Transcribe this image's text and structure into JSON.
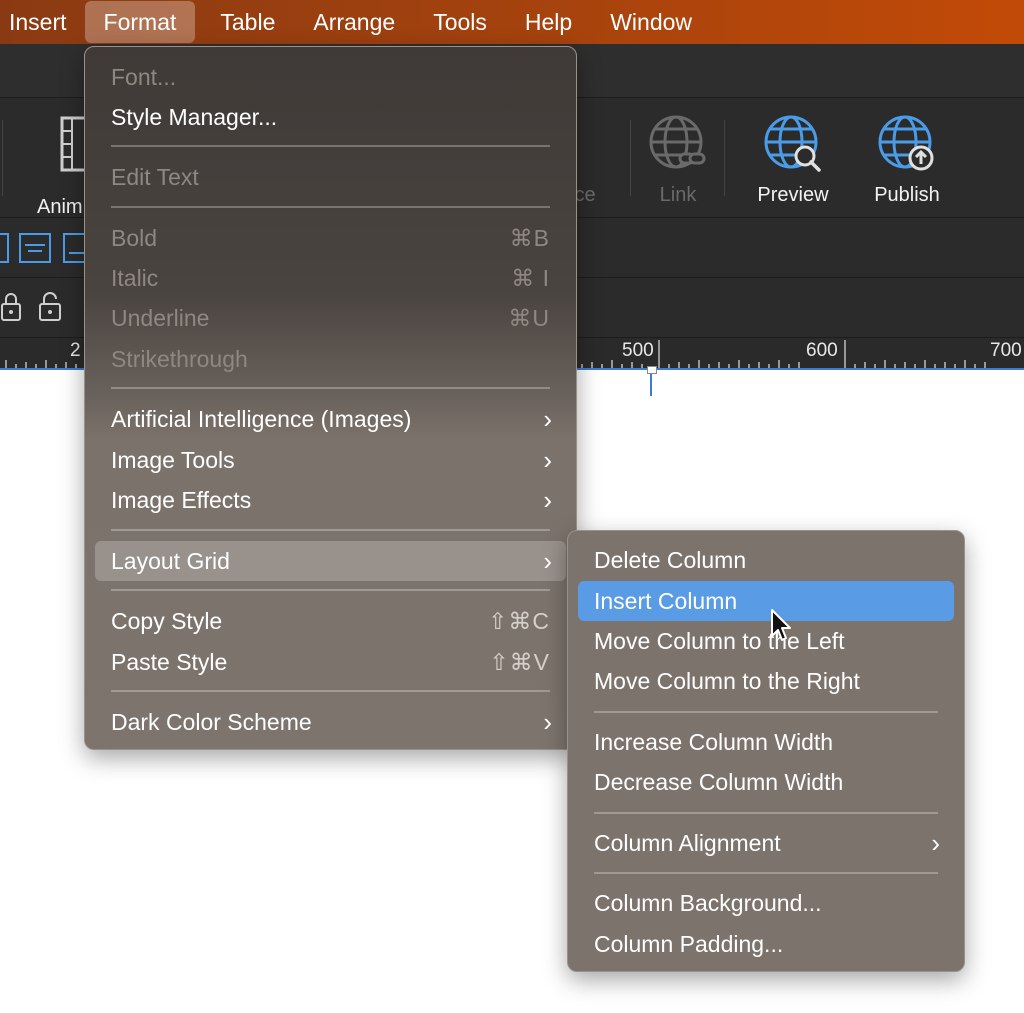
{
  "menubar": {
    "items": [
      "Insert",
      "Format",
      "Table",
      "Arrange",
      "Tools",
      "Help",
      "Window"
    ],
    "active": "Format"
  },
  "toolbar": {
    "animate_label": "Anim",
    "resource_label_fragment": "ce",
    "link_label": "Link",
    "preview_label": "Preview",
    "publish_label": "Publish",
    "accent_color": "#4a9ce8"
  },
  "ruler": {
    "labels": [
      "2",
      "500",
      "600",
      "700"
    ]
  },
  "format_menu": {
    "font": "Font...",
    "style_manager": "Style Manager...",
    "edit_text": "Edit Text",
    "bold": "Bold",
    "bold_sc": "⌘B",
    "italic": "Italic",
    "italic_sc": "⌘ I",
    "underline": "Underline",
    "underline_sc": "⌘U",
    "strikethrough": "Strikethrough",
    "ai_images": "Artificial Intelligence (Images)",
    "image_tools": "Image Tools",
    "image_effects": "Image Effects",
    "layout_grid": "Layout Grid",
    "copy_style": "Copy Style",
    "copy_style_sc": "⇧⌘C",
    "paste_style": "Paste Style",
    "paste_style_sc": "⇧⌘V",
    "dark_color_scheme": "Dark Color Scheme"
  },
  "layout_grid_menu": {
    "delete_column": "Delete Column",
    "insert_column": "Insert Column",
    "move_left": "Move Column to the Left",
    "move_right": "Move Column to the Right",
    "increase_width": "Increase Column Width",
    "decrease_width": "Decrease Column Width",
    "column_alignment": "Column Alignment",
    "column_background": "Column Background...",
    "column_padding": "Column Padding..."
  },
  "colors": {
    "menubar_gradient_start": "#8a3a12",
    "menubar_gradient_end": "#c24a08",
    "selection": "#5a9be6"
  }
}
